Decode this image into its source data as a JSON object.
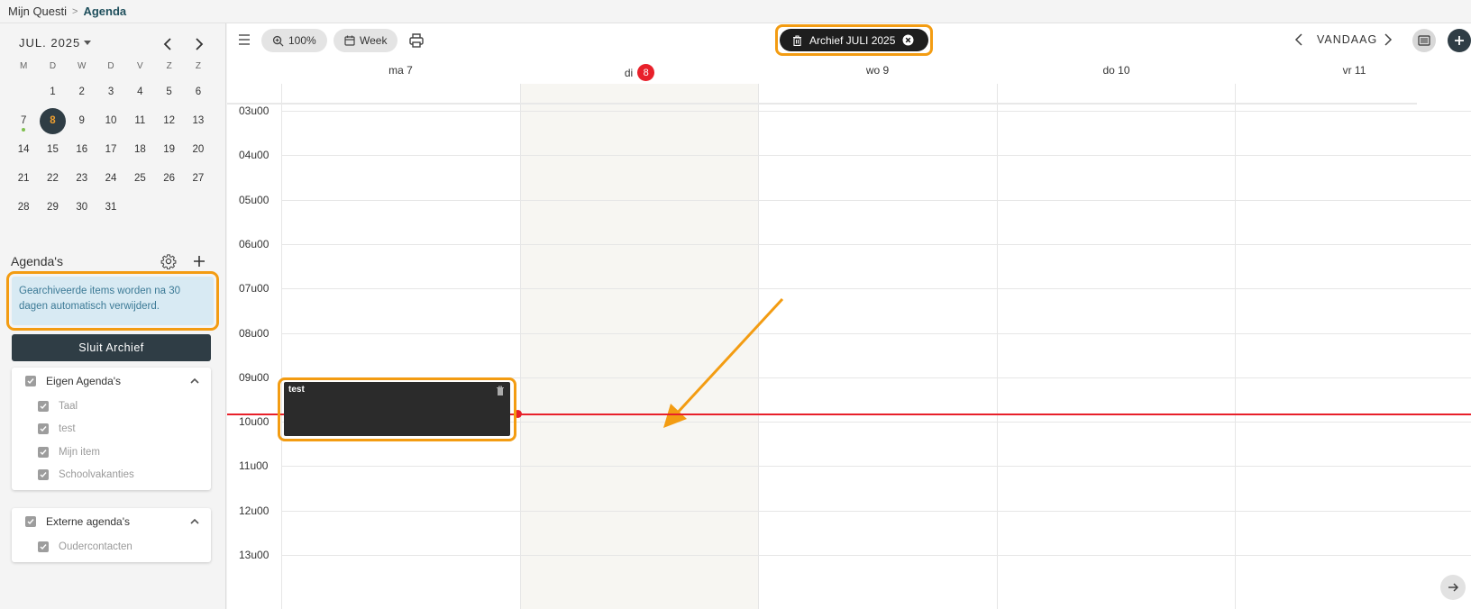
{
  "breadcrumb": {
    "home": "Mijn Questi",
    "separator": ">",
    "current": "Agenda"
  },
  "mini_calendar": {
    "month_label": "JUL. 2025",
    "weekdays": [
      "M",
      "D",
      "W",
      "D",
      "V",
      "Z",
      "Z"
    ],
    "weeks": [
      [
        "",
        "1",
        "2",
        "3",
        "4",
        "5",
        "6"
      ],
      [
        "7",
        "8",
        "9",
        "10",
        "11",
        "12",
        "13"
      ],
      [
        "14",
        "15",
        "16",
        "17",
        "18",
        "19",
        "20"
      ],
      [
        "21",
        "22",
        "23",
        "24",
        "25",
        "26",
        "27"
      ],
      [
        "28",
        "29",
        "30",
        "31",
        "",
        "",
        ""
      ]
    ],
    "selected_day": "8",
    "dot_day": "7"
  },
  "agendas": {
    "title": "Agenda's",
    "info_text": "Gearchiveerde items worden na 30 dagen automatisch verwijderd.",
    "close_archive_label": "Sluit Archief",
    "groups": [
      {
        "label": "Eigen Agenda's",
        "items": [
          "Taal",
          "test",
          "Mijn item",
          "Schoolvakanties"
        ]
      },
      {
        "label": "Externe agenda's",
        "items": [
          "Oudercontacten"
        ]
      }
    ]
  },
  "toolbar": {
    "zoom_label": "100%",
    "view_label": "Week",
    "archive_chip_label": "Archief JULI 2025",
    "today_label": "VANDAAG"
  },
  "week": {
    "days": [
      {
        "label": "ma 7",
        "badge": ""
      },
      {
        "label": "di",
        "badge": "8"
      },
      {
        "label": "wo 9",
        "badge": ""
      },
      {
        "label": "do 10",
        "badge": ""
      },
      {
        "label": "vr 11",
        "badge": ""
      }
    ],
    "hours": [
      "03u00",
      "04u00",
      "05u00",
      "06u00",
      "07u00",
      "08u00",
      "09u00",
      "10u00",
      "11u00",
      "12u00",
      "13u00"
    ]
  },
  "events": [
    {
      "title": "test",
      "day": "ma 7",
      "start": "08u30",
      "end": "09u30"
    }
  ],
  "colors": {
    "accent": "#f39c12",
    "primary": "#2f3d45",
    "today_red": "#e8202a",
    "link_teal": "#1f4f5c"
  },
  "icons": [
    "chevron-left-icon",
    "chevron-right-icon",
    "gear-icon",
    "plus-icon",
    "menu-icon",
    "zoom-icon",
    "calendar-icon",
    "print-icon",
    "trash-icon",
    "close-circle-icon",
    "list-icon",
    "arrow-right-icon",
    "check-icon",
    "chevron-up-icon"
  ]
}
